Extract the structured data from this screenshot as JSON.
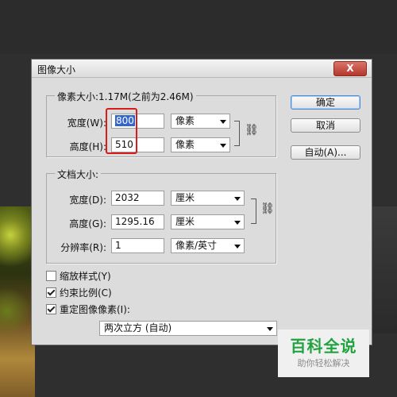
{
  "dialog": {
    "title": "图像大小",
    "close_label": "X"
  },
  "pixel_dims": {
    "legend": "像素大小:1.17M(之前为2.46M)",
    "width_label": "宽度(W):",
    "width_value": "800",
    "width_unit": "像素",
    "height_label": "高度(H):",
    "height_value": "510",
    "height_unit": "像素"
  },
  "doc_size": {
    "legend": "文档大小:",
    "width_label": "宽度(D):",
    "width_value": "2032",
    "width_unit": "厘米",
    "height_label": "高度(G):",
    "height_value": "1295.16",
    "height_unit": "厘米",
    "resolution_label": "分辨率(R):",
    "resolution_value": "1",
    "resolution_unit": "像素/英寸"
  },
  "buttons": {
    "ok": "确定",
    "cancel": "取消",
    "auto": "自动(A)..."
  },
  "options": {
    "scale_styles": {
      "label": "缩放样式(Y)",
      "checked": false
    },
    "constrain": {
      "label": "约束比例(C)",
      "checked": true
    },
    "resample": {
      "label": "重定图像像素(I):",
      "checked": true
    },
    "resample_method": "两次立方 (自动)"
  },
  "watermark": {
    "main": "百科全说",
    "sub": "助你轻松解决"
  },
  "colors": {
    "highlight_red": "#d81b1b",
    "selection_blue": "#3366cc",
    "watermark_green": "#21a340"
  }
}
